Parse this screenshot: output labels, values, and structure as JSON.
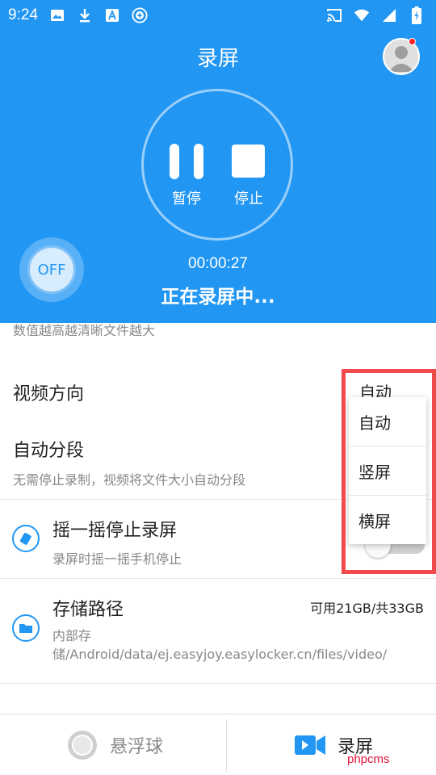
{
  "status_bar": {
    "time": "9:24",
    "left_icons": [
      "image-icon",
      "download-icon",
      "font-icon",
      "add-circle-icon"
    ],
    "right_icons": [
      "cast-icon",
      "wifi-icon",
      "signal-icon",
      "battery-charging-icon"
    ]
  },
  "header": {
    "title": "录屏"
  },
  "controls": {
    "pause_label": "暂停",
    "stop_label": "停止"
  },
  "float_ball": {
    "label": "OFF"
  },
  "recording": {
    "elapsed": "00:00:27",
    "status": "正在录屏中..."
  },
  "settings": {
    "quality_hint": "数值越高越清晰文件越大",
    "orientation": {
      "title": "视频方向",
      "value": "自动"
    },
    "auto_split": {
      "title": "自动分段",
      "subtitle": "无需停止录制，视频将文件大小自动分段"
    },
    "shake_stop": {
      "title": "摇一摇停止录屏",
      "subtitle": "录屏时摇一摇手机停止",
      "enabled": false
    },
    "storage": {
      "title": "存储路径",
      "capacity": "可用21GB/共33GB",
      "path": "内部存储/Android/data/ej.easyjoy.easylocker.cn/files/video/"
    }
  },
  "orientation_dropdown": {
    "options": [
      "自动",
      "竖屏",
      "横屏"
    ]
  },
  "bottom_nav": {
    "float_ball_label": "悬浮球",
    "record_label": "录屏"
  },
  "watermark": "phpcms",
  "colors": {
    "primary": "#2196f3",
    "highlight_border": "#f04a4d",
    "notification_dot": "#ff1e1e"
  }
}
